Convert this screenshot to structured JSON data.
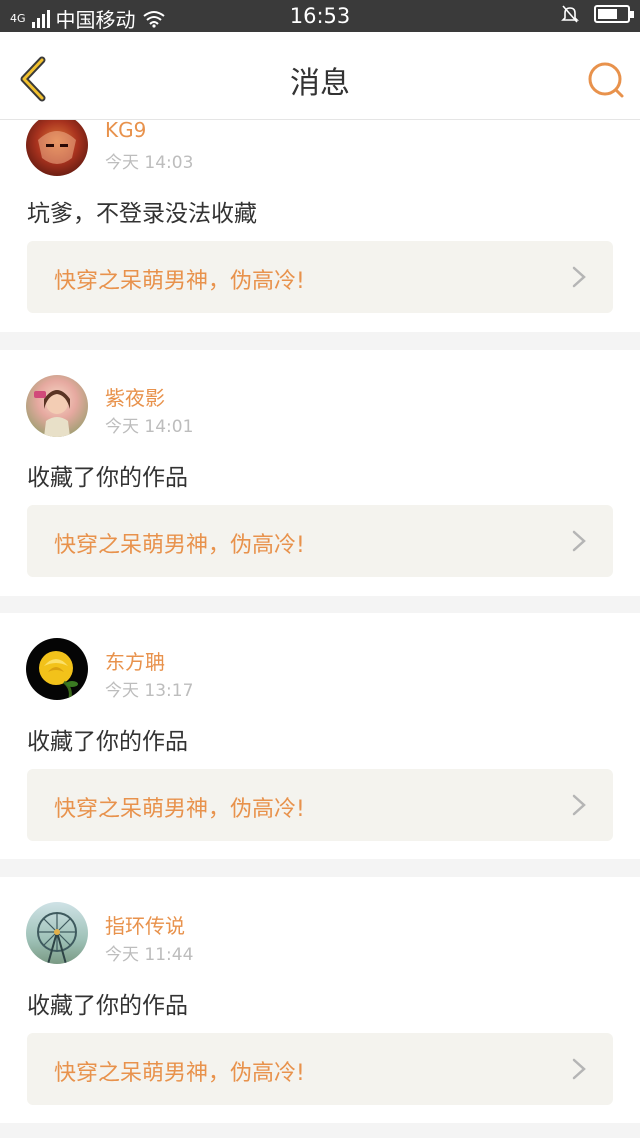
{
  "status_bar": {
    "network": "4G",
    "carrier": "中国移动",
    "time": "16:53"
  },
  "nav": {
    "title": "消息",
    "back_icon": "chevron-left-icon",
    "search_icon": "search-icon",
    "accent": "#e8924c"
  },
  "messages": [
    {
      "user": "KG9",
      "time": "今天 14:03",
      "text": "坑爹，不登录没法收藏",
      "work_title": "快穿之呆萌男神，伪高冷!"
    },
    {
      "user": "紫夜影",
      "time": "今天 14:01",
      "text": "收藏了你的作品",
      "work_title": "快穿之呆萌男神，伪高冷!"
    },
    {
      "user": "东方聃",
      "time": "今天 13:17",
      "text": "收藏了你的作品",
      "work_title": "快穿之呆萌男神，伪高冷!"
    },
    {
      "user": "指环传说",
      "time": "今天 11:44",
      "text": "收藏了你的作品",
      "work_title": "快穿之呆萌男神，伪高冷!"
    }
  ]
}
